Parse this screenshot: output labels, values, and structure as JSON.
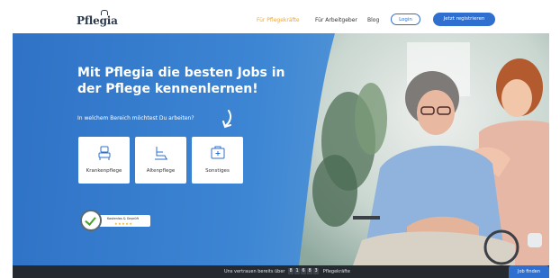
{
  "header": {
    "logo": "Pflegia",
    "nav": [
      {
        "label": "Für Pflegekräfte",
        "active": true
      },
      {
        "label": "Für Arbeitgeber",
        "active": false
      },
      {
        "label": "Blog",
        "active": false
      }
    ],
    "login_label": "Login",
    "register_label": "Jetzt registrieren"
  },
  "hero": {
    "title": "Mit Pflegia die besten Jobs in der Pflege kennenlernen!",
    "subtitle": "In welchem Bereich möchtest Du arbeiten?",
    "categories": [
      {
        "label": "Krankenpflege",
        "icon": "hospital-bed-icon"
      },
      {
        "label": "Altenpflege",
        "icon": "wheelchair-icon"
      },
      {
        "label": "Sonstiges",
        "icon": "medical-kit-icon"
      }
    ],
    "badge": {
      "text": "Kostenlos & Geprüft",
      "stars": "★★★★★"
    }
  },
  "footer": {
    "trust_prefix": "Uns vertrauen bereits über",
    "counter_digits": [
      "8",
      "1",
      "6",
      "8",
      "3"
    ],
    "trust_suffix": "Pflegekräfte",
    "job_button_label": "Job finden"
  },
  "colors": {
    "accent": "#2f6fd0",
    "active_nav": "#f6a623",
    "footer_bg": "#252a30"
  }
}
